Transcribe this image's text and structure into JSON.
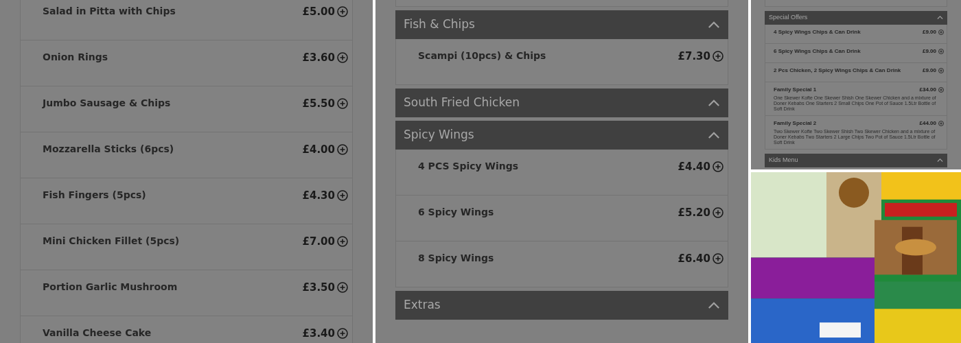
{
  "panels": [
    {
      "kind": "full",
      "top_card": false,
      "sections": [
        {
          "items": [
            {
              "name": "Salad in Pitta with Chips",
              "price": "£5.00"
            },
            {
              "name": "Onion Rings",
              "price": "£3.60"
            },
            {
              "name": "Jumbo Sausage & Chips",
              "price": "£5.50"
            },
            {
              "name": "Mozzarella Sticks (6pcs)",
              "price": "£4.00"
            },
            {
              "name": "Fish Fingers (5pcs)",
              "price": "£4.30"
            },
            {
              "name": "Mini Chicken Fillet (5pcs)",
              "price": "£7.00"
            },
            {
              "name": "Portion Garlic Mushroom",
              "price": "£3.50"
            },
            {
              "name": "Vanilla Cheese Cake",
              "price": "£3.40"
            }
          ]
        }
      ]
    },
    {
      "kind": "full",
      "top_card": true,
      "sections": [
        {
          "title": "Fish & Chips",
          "items": [
            {
              "name": "Scampi (10pcs) & Chips",
              "price": "£7.30"
            }
          ]
        },
        {
          "title": "South Fried Chicken"
        },
        {
          "title": "Spicy Wings",
          "items": [
            {
              "name": "4 PCS Spicy Wings",
              "price": "£4.40"
            },
            {
              "name": "6 Spicy Wings",
              "price": "£5.20"
            },
            {
              "name": "8 Spicy Wings",
              "price": "£6.40"
            }
          ]
        },
        {
          "title": "Extras"
        }
      ]
    },
    {
      "kind": "compact",
      "top_card": true,
      "sections": [
        {
          "title": "Special Offers",
          "items": [
            {
              "name": "4 Spicy Wings Chips & Can Drink",
              "price": "£9.00"
            },
            {
              "name": "6 Spicy Wings Chips & Can Drink",
              "price": "£9.00"
            },
            {
              "name": "2 Pcs Chicken, 2 Spicy Wings Chips & Can Drink",
              "price": "£9.00"
            },
            {
              "name": "Family Special 1",
              "price": "£34.00",
              "description": "One Skewer Kofte One Skewer Shish One Skewer Chicken and a mixture of Doner Kebabs One Starters 2 Small Chips One Pot of Sauce 1.5Ltr Bottle of Soft Drink"
            },
            {
              "name": "Family Special 2",
              "price": "£44.00",
              "description": "Two Skewer Kofte Two Skewer Shish Two Skewer Chicken and a mixture of Doner Kebabs Two Starters 2 Large Chips Two Pot of Sauce 1.5Ltr Bottle of Soft Drink"
            }
          ]
        },
        {
          "title": "Kids Menu"
        }
      ],
      "photo": {
        "kind": "picture"
      }
    }
  ]
}
